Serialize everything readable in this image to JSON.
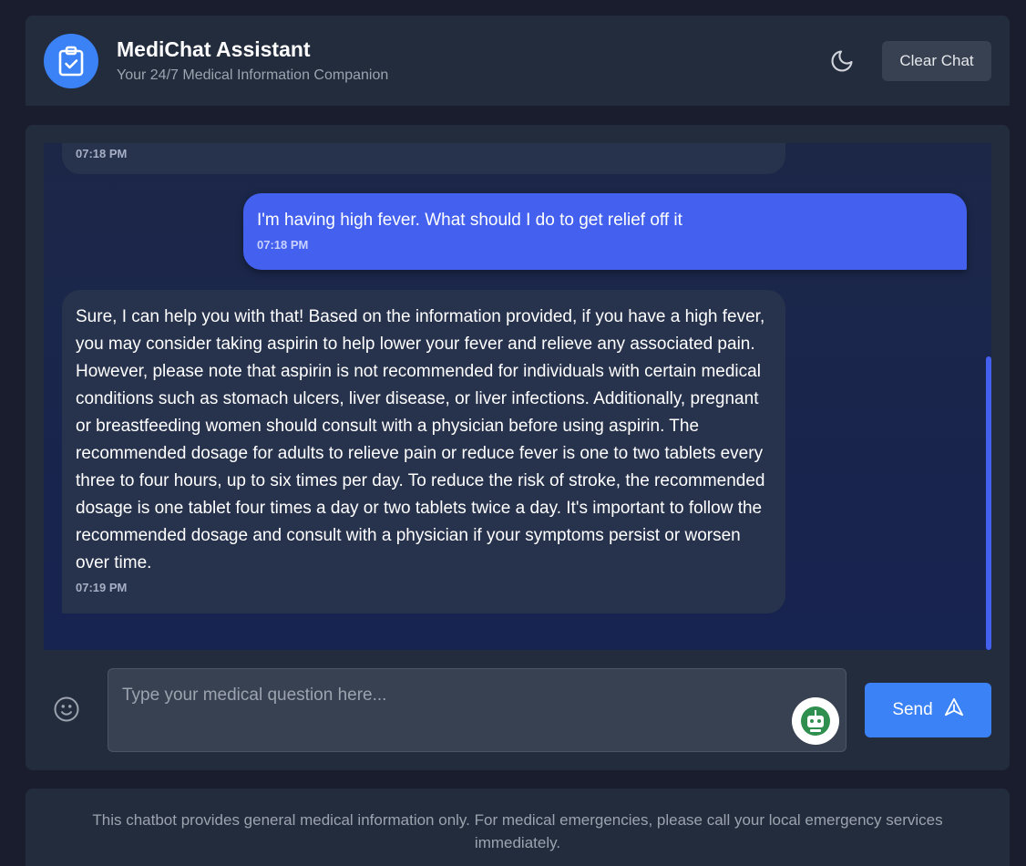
{
  "header": {
    "title": "MediChat Assistant",
    "subtitle": "Your 24/7 Medical Information Companion",
    "clear_label": "Clear Chat",
    "logo_icon": "clipboard-check-icon",
    "theme_icon": "moon-icon"
  },
  "messages": [
    {
      "role": "bot",
      "text": "",
      "time": "07:18 PM"
    },
    {
      "role": "user",
      "text": "I'm having high fever. What should I do to get relief off it",
      "time": "07:18 PM"
    },
    {
      "role": "bot",
      "text": "Sure, I can help you with that! Based on the information provided, if you have a high fever, you may consider taking aspirin to help lower your fever and relieve any associated pain. However, please note that aspirin is not recommended for individuals with certain medical conditions such as stomach ulcers, liver disease, or liver infections. Additionally, pregnant or breastfeeding women should consult with a physician before using aspirin. The recommended dosage for adults to relieve pain or reduce fever is one to two tablets every three to four hours, up to six times per day. To reduce the risk of stroke, the recommended dosage is one tablet four times a day or two tablets twice a day. It's important to follow the recommended dosage and consult with a physician if your symptoms persist or worsen over time.",
      "time": "07:19 PM"
    }
  ],
  "composer": {
    "placeholder": "Type your medical question here...",
    "send_label": "Send",
    "emoji_icon": "smiley-icon",
    "send_icon": "send-arrow-icon"
  },
  "footer": {
    "disclaimer": "This chatbot provides general medical information only. For medical emergencies, please call your local emergency services immediately."
  },
  "colors": {
    "accent": "#3b82f6",
    "user_bubble": "#4361ee",
    "bot_bubble": "#27324d",
    "background": "#1a1d2e",
    "panel": "#232c3d"
  }
}
